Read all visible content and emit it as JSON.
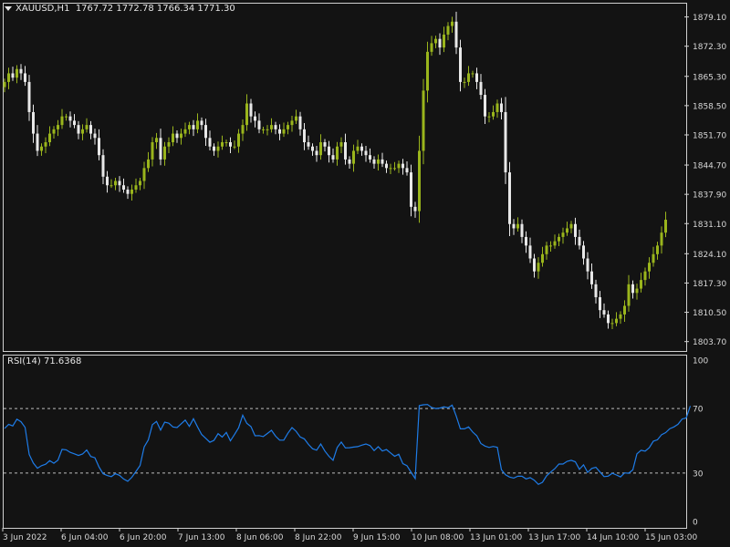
{
  "chart": {
    "symbol": "XAUUSD,H1",
    "ohlc": "1767.72 1772.78 1766.34 1771.30",
    "price_ticks": [
      "1879.10",
      "1872.30",
      "1865.30",
      "1858.50",
      "1851.70",
      "1844.70",
      "1837.90",
      "1831.10",
      "1824.10",
      "1817.30",
      "1810.50",
      "1803.70"
    ],
    "time_labels": [
      "3 Jun 2022",
      "6 Jun 04:00",
      "6 Jun 20:00",
      "7 Jun 13:00",
      "8 Jun 06:00",
      "8 Jun 22:00",
      "9 Jun 15:00",
      "10 Jun 08:00",
      "13 Jun 01:00",
      "13 Jun 17:00",
      "14 Jun 10:00",
      "15 Jun 03:00"
    ],
    "bull_color": "#9ab51c",
    "bear_color": "#e8e8e8",
    "background": "#131313"
  },
  "rsi": {
    "label": "RSI(14) 71.6368",
    "ticks": [
      "100",
      "70",
      "30",
      "0"
    ],
    "line_color": "#1e7ce8",
    "level_values": [
      70,
      30
    ]
  },
  "chart_data": [
    {
      "type": "candlestick",
      "title": "XAUUSD,H1",
      "series": [
        {
          "name": "XAUUSD,H1",
          "close": [
            1864,
            1866,
            1865,
            1867,
            1866,
            1864,
            1857,
            1852,
            1848,
            1849,
            1850,
            1852,
            1853,
            1854,
            1856,
            1856,
            1855,
            1854,
            1852,
            1853,
            1854,
            1852,
            1851,
            1847,
            1842,
            1840,
            1840,
            1841,
            1840,
            1839,
            1838,
            1839,
            1840,
            1841,
            1844,
            1846,
            1850,
            1851,
            1846,
            1849,
            1850,
            1852,
            1851,
            1852,
            1853,
            1854,
            1853,
            1855,
            1854,
            1851,
            1849,
            1848,
            1849,
            1850,
            1850,
            1849,
            1849,
            1852,
            1854,
            1859,
            1856,
            1855,
            1853,
            1853,
            1853,
            1854,
            1853,
            1852,
            1853,
            1854,
            1855,
            1856,
            1853,
            1850,
            1849,
            1848,
            1847,
            1850,
            1849,
            1847,
            1846,
            1849,
            1850,
            1846,
            1845,
            1848,
            1849,
            1848,
            1847,
            1846,
            1845,
            1846,
            1845,
            1844,
            1844,
            1844,
            1845,
            1844,
            1843,
            1835,
            1834,
            1848,
            1862,
            1871,
            1873,
            1874,
            1872,
            1875,
            1877,
            1878,
            1872,
            1864,
            1864,
            1866,
            1866,
            1864,
            1861,
            1856,
            1856,
            1857,
            1859,
            1857,
            1843,
            1831,
            1830,
            1831,
            1828,
            1826,
            1823,
            1820,
            1822,
            1824,
            1826,
            1826,
            1827,
            1828,
            1829,
            1830,
            1831,
            1828,
            1826,
            1823,
            1820,
            1817,
            1814,
            1811,
            1810,
            1808,
            1808,
            1809,
            1810,
            1812,
            1817,
            1815,
            1816,
            1818,
            1820,
            1822,
            1824,
            1826,
            1829,
            1832
          ]
        },
        {
          "name": "RSI(14)",
          "values": [
            57.6,
            60.2,
            59.2,
            63.4,
            61.8,
            58.3,
            41.5,
            36.2,
            33.0,
            34.6,
            35.5,
            37.7,
            36.1,
            38.0,
            44.7,
            44.4,
            42.8,
            41.9,
            40.9,
            41.8,
            44.3,
            40.3,
            39.5,
            33.8,
            29.6,
            28.5,
            27.8,
            29.6,
            28.6,
            26.3,
            24.9,
            27.4,
            31.0,
            34.7,
            46.2,
            50.5,
            60.0,
            62.0,
            56.6,
            61.5,
            60.9,
            58.6,
            58.2,
            60.5,
            62.8,
            58.9,
            63.7,
            58.6,
            53.9,
            51.5,
            49.1,
            50.3,
            54.4,
            52.3,
            55.2,
            50.0,
            53.9,
            58.1,
            65.9,
            60.8,
            58.8,
            53.1,
            53.2,
            52.6,
            54.5,
            56.5,
            52.9,
            50.4,
            50.4,
            54.7,
            58.2,
            55.9,
            52.4,
            51.2,
            47.8,
            45.1,
            44.2,
            48.0,
            43.7,
            40.4,
            37.9,
            45.8,
            49.2,
            45.6,
            45.7,
            46.1,
            46.4,
            47.3,
            48.0,
            47.0,
            43.9,
            46.3,
            43.7,
            44.6,
            42.5,
            40.4,
            41.7,
            35.8,
            34.6,
            30.5,
            26.6,
            71.8,
            72.3,
            72.5,
            70.6,
            70.0,
            70.3,
            71.0,
            70.5,
            72.1,
            65.3,
            57.4,
            57.4,
            58.6,
            55.4,
            53.1,
            48.3,
            46.7,
            45.9,
            46.5,
            46.0,
            32.1,
            28.9,
            27.5,
            26.9,
            28.1,
            28.0,
            26.4,
            27.2,
            25.6,
            23.0,
            24.3,
            28.3,
            30.6,
            32.7,
            35.6,
            35.6,
            37.3,
            37.9,
            37.0,
            32.3,
            35.1,
            30.4,
            32.9,
            33.6,
            30.7,
            27.8,
            28.1,
            29.9,
            28.8,
            27.6,
            30.1,
            29.9,
            32.0,
            41.9,
            44.1,
            43.6,
            45.7,
            49.8,
            50.6,
            53.8,
            55.1,
            57.5,
            58.6,
            60.2,
            63.5,
            64.1,
            71.6
          ]
        }
      ],
      "ylim": [
        1803.7,
        1879.1
      ],
      "grid": false
    }
  ]
}
